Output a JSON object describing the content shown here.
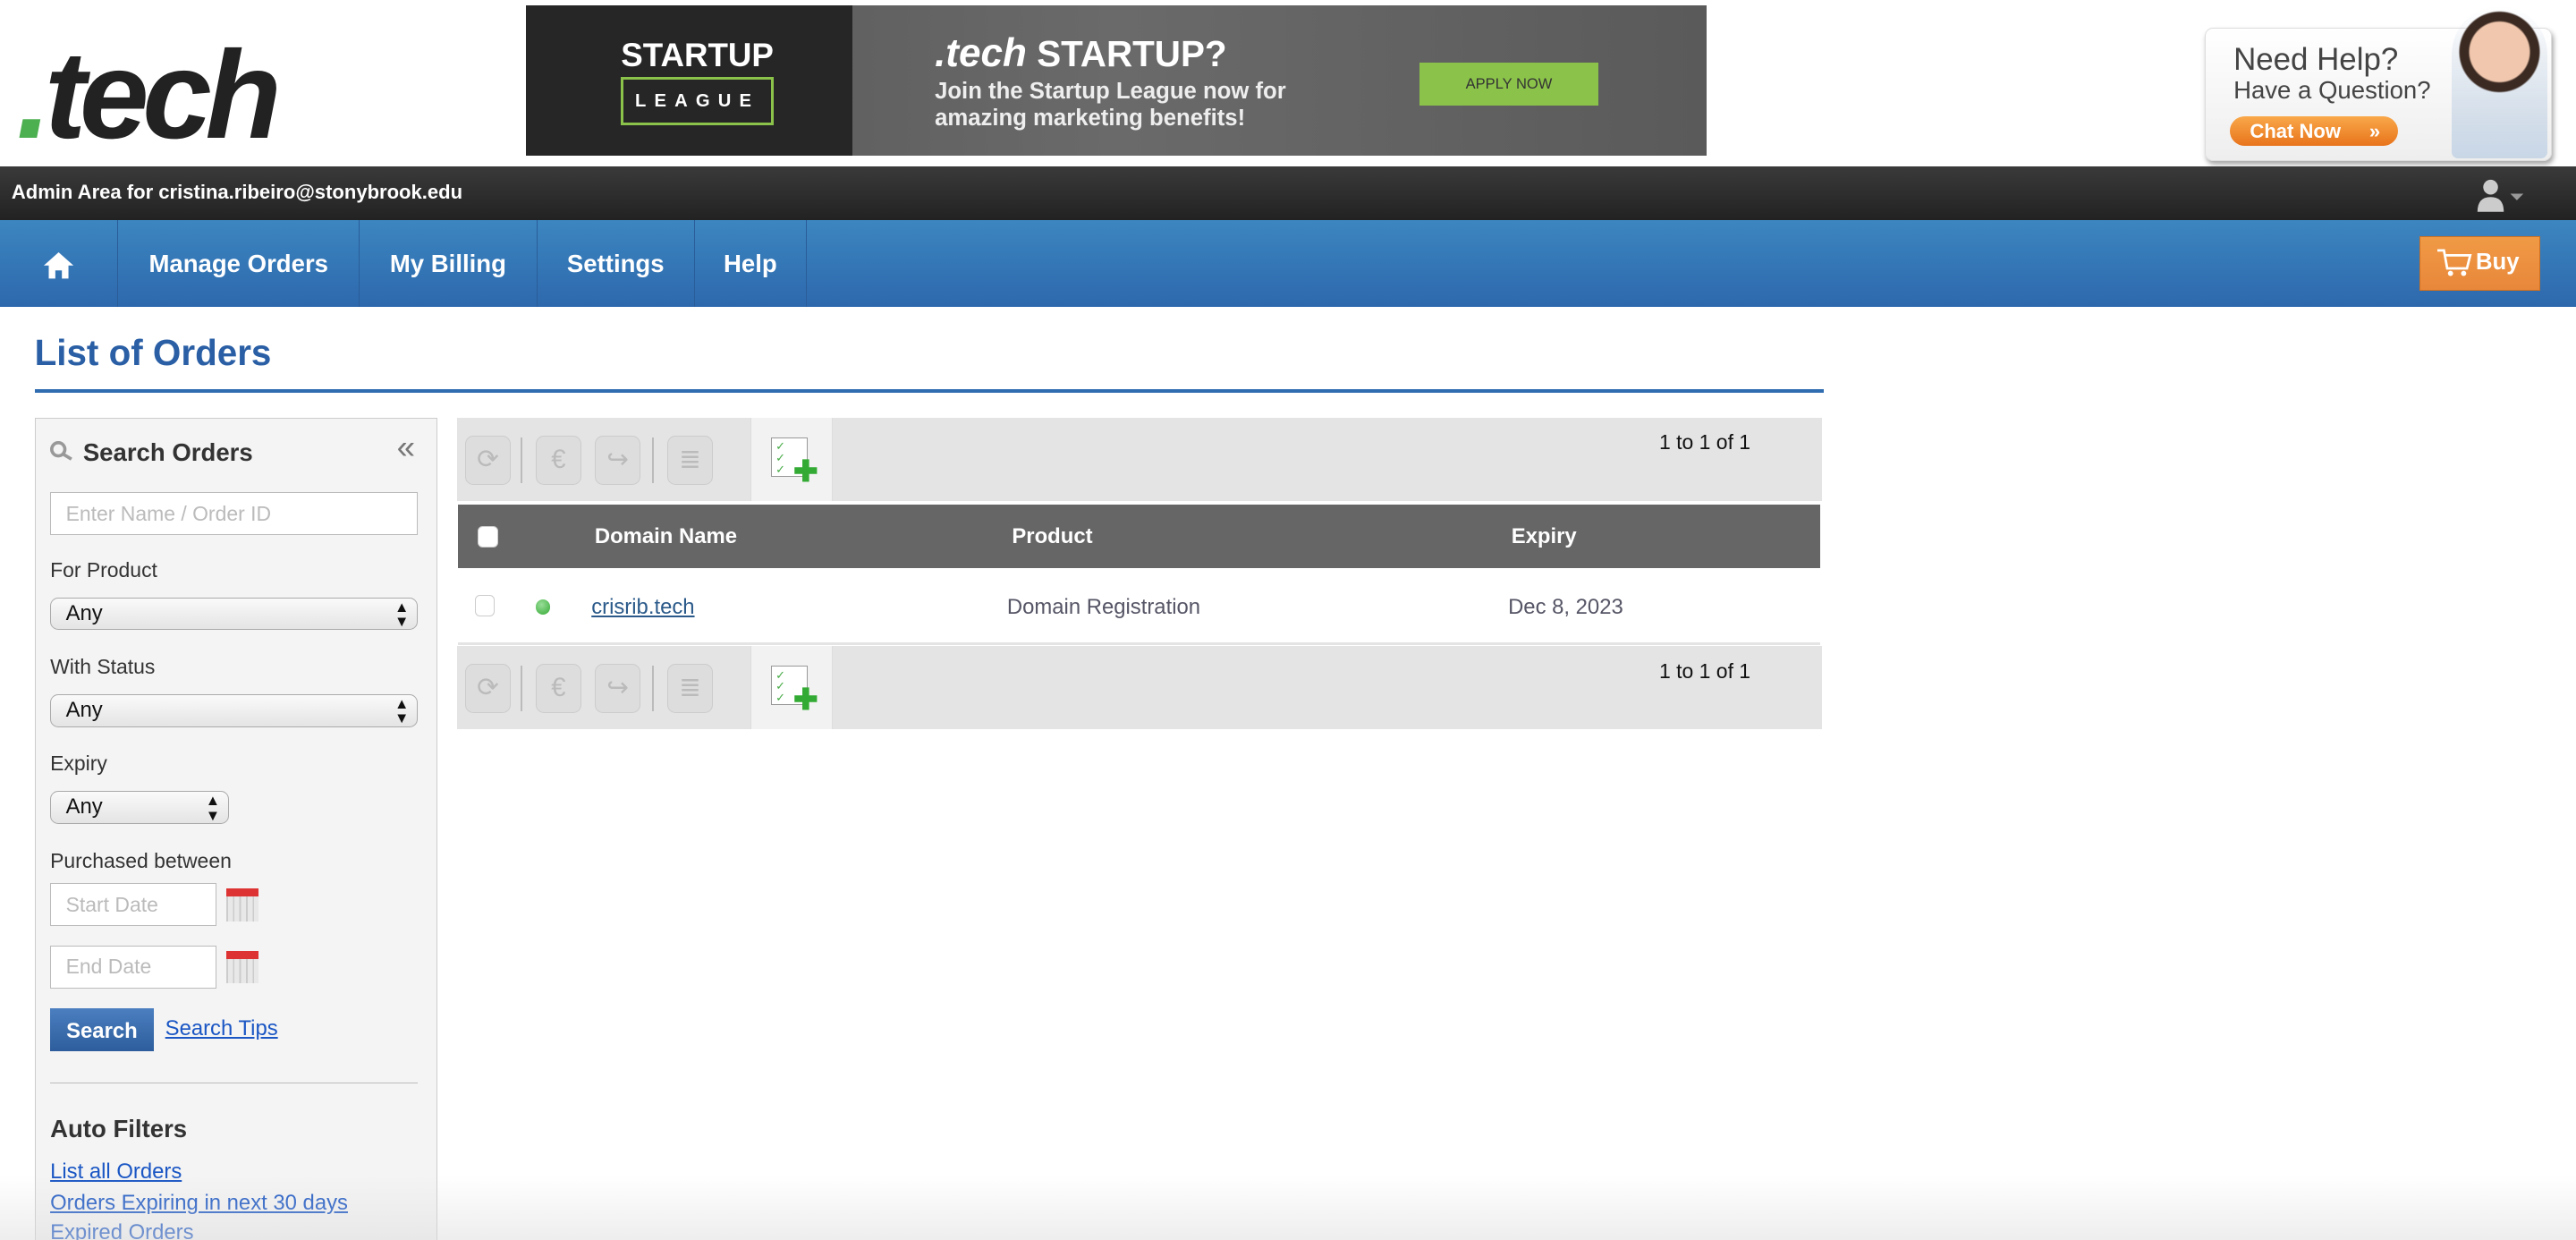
{
  "logo": {
    "dot": ".",
    "text": "tech"
  },
  "banner": {
    "brand_top": "STARTUP",
    "brand_bottom": "LEAGUE",
    "headline_brand": ".tech",
    "headline": "STARTUP?",
    "subtext": "Join the Startup League now for amazing marketing benefits!",
    "cta": "APPLY NOW"
  },
  "help": {
    "line1": "Need Help?",
    "line2": "Have a Question?",
    "chat": "Chat Now"
  },
  "topbar": {
    "admin_text": "Admin Area for cristina.ribeiro@stonybrook.edu"
  },
  "nav": {
    "items": [
      {
        "label": "Manage Orders"
      },
      {
        "label": "My Billing"
      },
      {
        "label": "Settings"
      },
      {
        "label": "Help"
      }
    ],
    "buy": "Buy"
  },
  "page": {
    "title": "List of Orders"
  },
  "sidebar": {
    "title": "Search Orders",
    "search_placeholder": "Enter Name / Order ID",
    "product_label": "For Product",
    "product_value": "Any",
    "status_label": "With Status",
    "status_value": "Any",
    "expiry_label": "Expiry",
    "expiry_value": "Any",
    "purchased_label": "Purchased between",
    "start_placeholder": "Start Date",
    "end_placeholder": "End Date",
    "search_button": "Search",
    "search_tips": "Search Tips",
    "auto_filters_title": "Auto Filters",
    "auto_filters": [
      "List all Orders",
      "Orders Expiring in next 30 days",
      "Expired Orders"
    ]
  },
  "pagination": {
    "text": "1 to 1 of 1"
  },
  "table": {
    "headers": [
      "Domain Name",
      "Product",
      "Expiry"
    ],
    "rows": [
      {
        "domain": "crisrib.tech",
        "product": "Domain Registration",
        "expiry": "Dec 8, 2023",
        "status_color": "#4caf50"
      }
    ]
  }
}
